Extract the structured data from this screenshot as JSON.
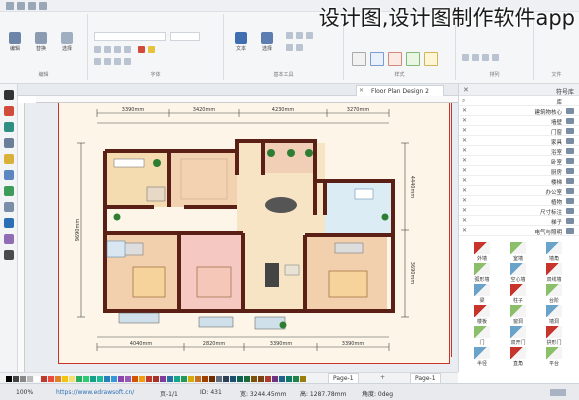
{
  "watermark": "设计图,设计图制作软件app",
  "ribbon": {
    "groups": [
      {
        "label": "编辑",
        "buttons": [
          "编辑",
          "替换",
          "选择"
        ]
      },
      {
        "label": "字体",
        "buttons": []
      },
      {
        "label": "基本工具",
        "buttons": [
          "文本",
          "选择"
        ]
      },
      {
        "label": "样式",
        "buttons": []
      },
      {
        "label": "排列",
        "buttons": []
      }
    ],
    "file_label": "文件",
    "right_group": "选择"
  },
  "tabs": {
    "document": "Floor Plan Design 2"
  },
  "library": {
    "title": "符号库",
    "search": "库",
    "items": [
      "建筑物核心",
      "墙壁",
      "门窗",
      "家具",
      "浴室",
      "卧室",
      "厨房",
      "楼梯",
      "办公室",
      "植物",
      "尺寸标注",
      "梯子",
      "电气与照明"
    ],
    "shapes": [
      "外墙",
      "室墙",
      "墙角",
      "弧形墙",
      "空心墙",
      "双线墙",
      "梁",
      "柱子",
      "台阶",
      "楼板",
      "窗洞",
      "墙洞",
      "门",
      "双开门",
      "拱形门",
      "半径",
      "直角",
      "平台"
    ]
  },
  "page_nav": {
    "current": "Page-1",
    "tab": "Page-1"
  },
  "status": {
    "url": "https://www.edrawsoft.cn/",
    "page": "页-1/1",
    "shape_id": "ID: 431",
    "width": "宽: 3244.45mm",
    "height": "高: 1287.78mm",
    "angle": "角度: 0deg",
    "zoom": "100%"
  },
  "floorplan": {
    "dims_top": [
      "3390mm",
      "3420mm",
      "4230mm",
      "3270mm"
    ],
    "dims_bottom": [
      "4040mm",
      "2820mm",
      "3390mm",
      "3390mm"
    ],
    "dims_left": "9690mm",
    "dims_right": [
      "4440mm",
      "3690mm"
    ]
  },
  "colors": {
    "wall": "#5a2015",
    "accent": "#c6342b",
    "ribbon": "#f5f6f8",
    "page": "#fdf6e8"
  }
}
